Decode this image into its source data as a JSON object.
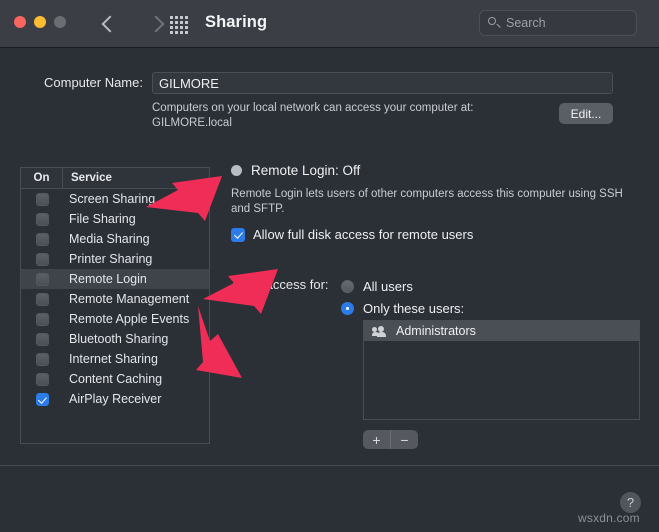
{
  "window": {
    "title": "Sharing",
    "accent_color": "#2b7ce8",
    "annotation_color": "#ef2d56",
    "toolbar_bg": "#3b3e44",
    "content_bg": "#2b2f36"
  },
  "toolbar": {
    "traffic_lights": [
      "close",
      "minimize",
      "zoom"
    ],
    "back_label": "Back",
    "forward_label": "Forward",
    "grid_label": "Show All",
    "search": {
      "placeholder": "Search",
      "value": ""
    }
  },
  "computer_name": {
    "label": "Computer Name:",
    "value": "GILMORE",
    "description": "Computers on your local network can access your computer at:\nGILMORE.local",
    "edit_button": "Edit..."
  },
  "services_table": {
    "columns": [
      "On",
      "Service"
    ],
    "rows": [
      {
        "name": "Screen Sharing",
        "on": false,
        "selected": false
      },
      {
        "name": "File Sharing",
        "on": false,
        "selected": false
      },
      {
        "name": "Media Sharing",
        "on": false,
        "selected": false
      },
      {
        "name": "Printer Sharing",
        "on": false,
        "selected": false
      },
      {
        "name": "Remote Login",
        "on": false,
        "selected": true
      },
      {
        "name": "Remote Management",
        "on": false,
        "selected": false
      },
      {
        "name": "Remote Apple Events",
        "on": false,
        "selected": false
      },
      {
        "name": "Bluetooth Sharing",
        "on": false,
        "selected": false
      },
      {
        "name": "Internet Sharing",
        "on": false,
        "selected": false
      },
      {
        "name": "Content Caching",
        "on": false,
        "selected": false
      },
      {
        "name": "AirPlay Receiver",
        "on": true,
        "selected": false
      }
    ]
  },
  "detail": {
    "status": "Remote Login: Off",
    "status_on": false,
    "description": "Remote Login lets users of other computers access this computer using SSH and SFTP.",
    "full_disk_access": {
      "label": "Allow full disk access for remote users",
      "checked": true
    },
    "access": {
      "label": "Allow access for:",
      "options": [
        {
          "label": "All users",
          "selected": false
        },
        {
          "label": "Only these users:",
          "selected": true
        }
      ]
    },
    "users": [
      {
        "name": "Administrators",
        "icon": "group-icon",
        "selected": true
      }
    ],
    "add_button": "+",
    "remove_button": "−"
  },
  "footer": {
    "help_button": "?",
    "watermark": "wsxdn.com"
  }
}
